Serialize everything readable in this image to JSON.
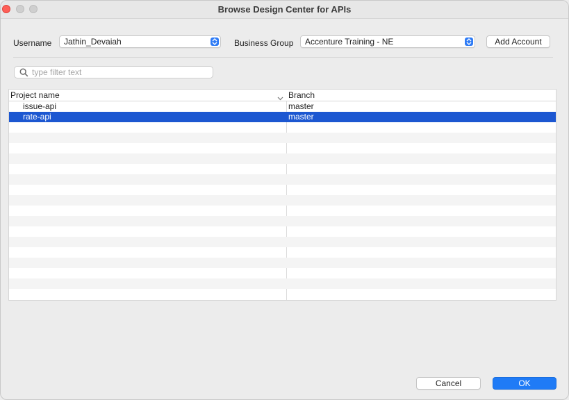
{
  "window": {
    "title": "Browse Design Center for APIs"
  },
  "form": {
    "username_label": "Username",
    "username_value": "Jathin_Devaiah",
    "business_group_label": "Business Group",
    "business_group_value": "Accenture Training - NE",
    "add_account_label": "Add Account"
  },
  "filter": {
    "placeholder": "type filter text",
    "value": ""
  },
  "table": {
    "columns": [
      "Project name",
      "Branch"
    ],
    "rows": [
      {
        "project": "issue-api",
        "branch": "master",
        "selected": false
      },
      {
        "project": "rate-api",
        "branch": "master",
        "selected": true
      }
    ]
  },
  "footer": {
    "cancel_label": "Cancel",
    "ok_label": "OK"
  },
  "colors": {
    "accent": "#1f7bf6",
    "selection": "#1c57d1",
    "close": "#fe5f57"
  },
  "icons": [
    "close-icon",
    "minimize-icon",
    "zoom-icon",
    "popup-stepper-icon",
    "search-icon",
    "sort-chevron-icon"
  ]
}
